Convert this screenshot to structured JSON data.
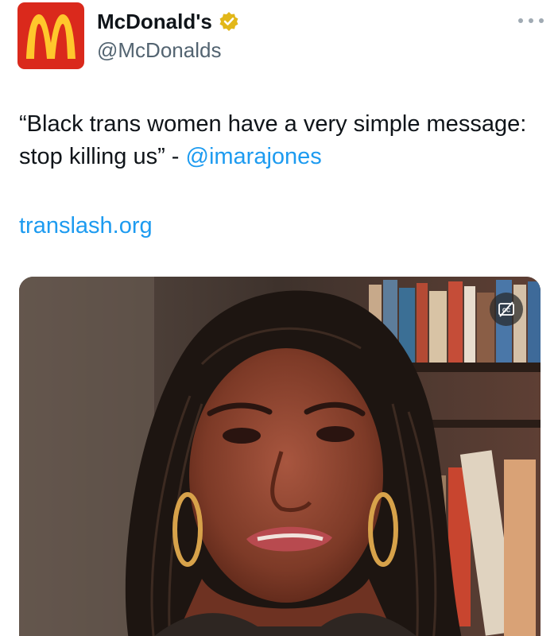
{
  "tweet": {
    "author": {
      "name": "McDonald's",
      "handle": "@McDonalds",
      "logo_letter": "M",
      "logo_bg": "#da291c",
      "logo_fg": "#ffc72c",
      "verified_badge_color": "#e2b719"
    },
    "text_main": "“Black trans women have a very simple message: stop killing us” - ",
    "mention": "@imarajones",
    "link": "translash.org",
    "more_icon": "more-dots-icon",
    "media": {
      "type": "video",
      "captions_icon": "closed-captions-off-icon"
    }
  },
  "colors": {
    "link": "#1d9bf0",
    "text": "#0f1419",
    "muted": "#536471"
  }
}
